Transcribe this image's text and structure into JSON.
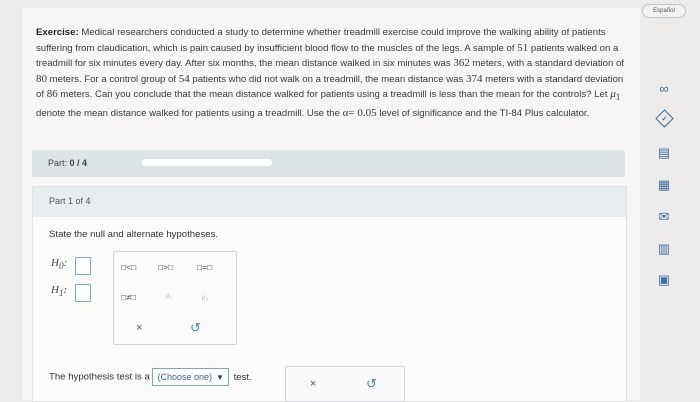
{
  "header": {
    "language_button": "Español"
  },
  "exercise": {
    "label": "Exercise:",
    "text_1": "Medical researchers conducted a study to determine whether treadmill exercise could improve the walking ability of patients suffering from claudication, which is pain caused by insufficient blood flow to the muscles of the legs. A sample of",
    "n1": "51",
    "text_2": "patients walked on a treadmill for six minutes every day. After six months, the mean distance walked in six minutes was",
    "mean1": "362",
    "text_3": "meters, with a standard deviation of",
    "sd1": "80",
    "text_4": "meters. For a control group of",
    "n2": "54",
    "text_5": "patients who did not walk on a treadmill, the mean distance was",
    "mean2": "374",
    "text_6": "meters with a standard deviation of",
    "sd2": "86",
    "text_7": "meters. Can you conclude that the mean distance walked for patients using a treadmill is less than the mean for the controls? Let",
    "mu1": "μ",
    "mu1_sub": "1",
    "text_8": "denote the mean distance walked for patients using a treadmill. Use the",
    "alpha": "α",
    "alpha_eq": "= 0.05",
    "text_9": "level of significance and the TI-84 Plus calculator."
  },
  "part_progress": {
    "label": "Part:",
    "value": "0 / 4",
    "fraction": 0.0
  },
  "part": {
    "title": "Part 1 of 4"
  },
  "prompt": "State the null and alternate hypotheses.",
  "hypotheses": {
    "h0_letter": "H",
    "h0_sub": "0",
    "h0_colon": ":",
    "h1_letter": "H",
    "h1_sub": "1",
    "h1_colon": ":"
  },
  "palette": {
    "lt": "□<□",
    "gt": "□>□",
    "eq": "□=□",
    "neq": "□≠□",
    "mu1": "μ₁",
    "mu2": "μ₂",
    "clear": "×",
    "undo": "↺"
  },
  "hypothesis_test": {
    "before": "The hypothesis test is a",
    "select_value": "(Choose one)",
    "arrow": "▼",
    "after": "test."
  },
  "bottom_tools": {
    "clear": "×",
    "undo": "↺"
  },
  "sidebar_tools": {
    "infinity": "∞",
    "check": "✔",
    "ebook": "▤",
    "calculator": "▦",
    "mail": "✉",
    "stats": "▥",
    "table": "▣"
  }
}
